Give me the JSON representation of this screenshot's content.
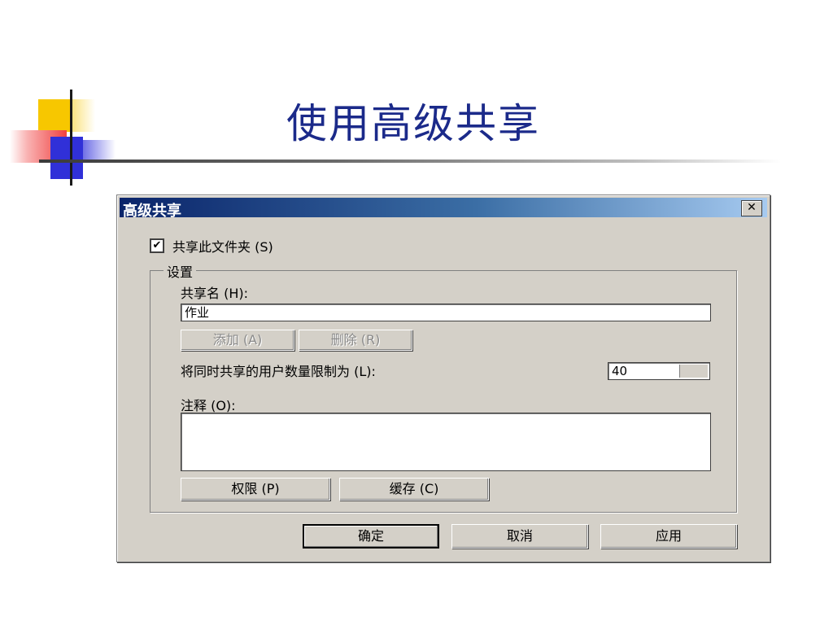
{
  "slide": {
    "title": "使用高级共享"
  },
  "dialog": {
    "title": "高级共享",
    "close_label": "✕",
    "share_checkbox": {
      "label": "共享此文件夹 (S)",
      "checked": true
    },
    "settings_group": {
      "legend": "设置",
      "share_name_label": "共享名 (H):",
      "share_name_value": "作业",
      "add_button": "添加 (A)",
      "remove_button": "删除 (R)",
      "user_limit_label": "将同时共享的用户数量限制为 (L):",
      "user_limit_value": "40",
      "comment_label": "注释 (O):",
      "comment_value": "",
      "permissions_button": "权限 (P)",
      "caching_button": "缓存 (C)"
    },
    "ok_button": "确定",
    "cancel_button": "取消",
    "apply_button": "应用"
  },
  "colors": {
    "title_text": "#1b2a8a",
    "titlebar_start": "#0a246a",
    "titlebar_end": "#a6caf0",
    "dialog_face": "#d4d0c8"
  }
}
